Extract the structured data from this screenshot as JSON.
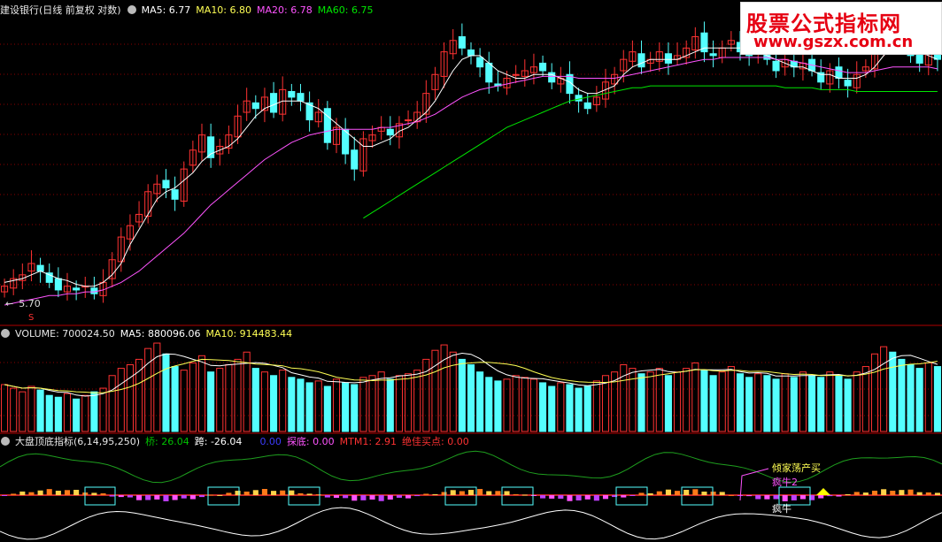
{
  "logo": {
    "line1": "股票公式指标网",
    "line2": "www.gszx.com.cn"
  },
  "price_panel": {
    "title": "建设银行(日线 前复权 对数)",
    "ma5": "MA5: 6.77",
    "ma10": "MA10: 6.80",
    "ma20": "MA20: 6.78",
    "ma60": "MA60: 6.75",
    "low_label": "5.70",
    "marker": "S"
  },
  "volume_panel": {
    "vol": "VOLUME: 700024.50",
    "ma5": "MA5: 880096.06",
    "ma10": "MA10: 914483.44"
  },
  "indicator_panel": {
    "name": "大盘顶底指标(6,14,95,250)",
    "qiao": "桥: 26.04",
    "kua": "跨: -26.04",
    "zero": "0.00",
    "tandi": "探底: 0.00",
    "mtm1": "MTM1: 2.91",
    "jiajia": "绝佳买点: 0.00",
    "annot_a": "倾家荡产买",
    "annot_b": "疯牛2",
    "annot_c": "疯牛"
  },
  "colors": {
    "up": "#ff3232",
    "down": "#54ffff",
    "ma5": "#ffffff",
    "ma10": "#ffff54",
    "ma20": "#ff54ff",
    "ma60": "#00e600",
    "grid": "#8b0000"
  },
  "chart_data": {
    "type": "candlestick",
    "price_close": [
      5.72,
      5.76,
      5.78,
      5.84,
      5.8,
      5.74,
      5.7,
      5.72,
      5.7,
      5.72,
      5.68,
      5.74,
      5.86,
      5.98,
      6.04,
      6.1,
      6.22,
      6.26,
      6.24,
      6.18,
      6.34,
      6.44,
      6.52,
      6.4,
      6.46,
      6.52,
      6.62,
      6.7,
      6.66,
      6.72,
      6.64,
      6.76,
      6.72,
      6.7,
      6.6,
      6.64,
      6.48,
      6.56,
      6.42,
      6.34,
      6.5,
      6.52,
      6.56,
      6.52,
      6.58,
      6.6,
      6.64,
      6.74,
      6.84,
      6.96,
      7.02,
      6.98,
      6.94,
      6.88,
      6.8,
      6.78,
      6.82,
      6.84,
      6.86,
      6.88,
      6.86,
      6.8,
      6.82,
      6.74,
      6.7,
      6.66,
      6.72,
      6.8,
      6.84,
      6.92,
      6.96,
      6.88,
      6.92,
      6.96,
      6.9,
      6.94,
      6.98,
      7.04,
      6.96,
      6.94,
      6.98,
      7.02,
      6.96,
      6.94,
      6.98,
      6.92,
      6.86,
      6.92,
      6.88,
      6.9,
      6.86,
      6.8,
      6.86,
      6.82,
      6.78,
      6.84,
      6.88,
      7.0,
      7.08,
      7.04,
      6.98,
      6.94,
      6.9,
      6.96,
      6.92
    ],
    "ma5": [
      5.74,
      5.75,
      5.76,
      5.78,
      5.8,
      5.78,
      5.76,
      5.75,
      5.73,
      5.72,
      5.72,
      5.74,
      5.78,
      5.84,
      5.94,
      6.02,
      6.1,
      6.18,
      6.22,
      6.24,
      6.28,
      6.32,
      6.38,
      6.42,
      6.44,
      6.46,
      6.5,
      6.56,
      6.62,
      6.66,
      6.68,
      6.7,
      6.7,
      6.7,
      6.68,
      6.66,
      6.62,
      6.58,
      6.54,
      6.5,
      6.46,
      6.46,
      6.48,
      6.5,
      6.54,
      6.56,
      6.6,
      6.64,
      6.7,
      6.78,
      6.86,
      6.92,
      6.94,
      6.94,
      6.9,
      6.86,
      6.84,
      6.82,
      6.82,
      6.84,
      6.84,
      6.84,
      6.82,
      6.8,
      6.76,
      6.74,
      6.74,
      6.76,
      6.78,
      6.84,
      6.88,
      6.9,
      6.92,
      6.92,
      6.92,
      6.92,
      6.94,
      6.96,
      6.98,
      6.98,
      6.98,
      6.98,
      6.98,
      6.96,
      6.96,
      6.94,
      6.92,
      6.9,
      6.88,
      6.88,
      6.86,
      6.84,
      6.84,
      6.82,
      6.82,
      6.82,
      6.84,
      6.88,
      6.94,
      6.98,
      7.0,
      6.98,
      6.96,
      6.94,
      6.92
    ],
    "ma20": [
      5.62,
      5.63,
      5.64,
      5.65,
      5.66,
      5.67,
      5.67,
      5.68,
      5.68,
      5.69,
      5.69,
      5.7,
      5.72,
      5.74,
      5.77,
      5.8,
      5.84,
      5.88,
      5.92,
      5.96,
      6.0,
      6.05,
      6.1,
      6.15,
      6.19,
      6.23,
      6.27,
      6.31,
      6.35,
      6.39,
      6.42,
      6.45,
      6.48,
      6.5,
      6.52,
      6.53,
      6.54,
      6.55,
      6.55,
      6.55,
      6.55,
      6.55,
      6.56,
      6.56,
      6.57,
      6.58,
      6.59,
      6.61,
      6.63,
      6.66,
      6.69,
      6.72,
      6.74,
      6.76,
      6.77,
      6.78,
      6.79,
      6.8,
      6.81,
      6.82,
      6.83,
      6.83,
      6.83,
      6.83,
      6.82,
      6.82,
      6.82,
      6.82,
      6.82,
      6.83,
      6.84,
      6.85,
      6.86,
      6.87,
      6.88,
      6.89,
      6.9,
      6.91,
      6.92,
      6.92,
      6.93,
      6.93,
      6.93,
      6.93,
      6.93,
      6.93,
      6.92,
      6.92,
      6.91,
      6.9,
      6.89,
      6.88,
      6.87,
      6.86,
      6.85,
      6.85,
      6.85,
      6.86,
      6.87,
      6.88,
      6.88,
      6.88,
      6.88,
      6.88,
      6.87
    ],
    "ma60_start_index": 40,
    "ma60": [
      6.08,
      6.11,
      6.14,
      6.17,
      6.2,
      6.23,
      6.26,
      6.29,
      6.32,
      6.35,
      6.38,
      6.41,
      6.44,
      6.47,
      6.5,
      6.53,
      6.56,
      6.58,
      6.6,
      6.62,
      6.64,
      6.66,
      6.68,
      6.7,
      6.71,
      6.72,
      6.73,
      6.74,
      6.75,
      6.76,
      6.77,
      6.77,
      6.78,
      6.78,
      6.78,
      6.78,
      6.78,
      6.78,
      6.78,
      6.78,
      6.78,
      6.78,
      6.78,
      6.78,
      6.78,
      6.78,
      6.78,
      6.77,
      6.77,
      6.77,
      6.77,
      6.76,
      6.76,
      6.76,
      6.76,
      6.75,
      6.75,
      6.75,
      6.75,
      6.75,
      6.75,
      6.75,
      6.75,
      6.75,
      6.75
    ],
    "volume": [
      0.52,
      0.48,
      0.44,
      0.5,
      0.46,
      0.4,
      0.38,
      0.42,
      0.36,
      0.4,
      0.44,
      0.48,
      0.62,
      0.7,
      0.74,
      0.8,
      0.92,
      0.98,
      0.86,
      0.72,
      0.68,
      0.76,
      0.84,
      0.66,
      0.7,
      0.74,
      0.8,
      0.88,
      0.7,
      0.66,
      0.62,
      0.68,
      0.6,
      0.58,
      0.54,
      0.56,
      0.5,
      0.58,
      0.54,
      0.52,
      0.6,
      0.62,
      0.66,
      0.58,
      0.62,
      0.64,
      0.68,
      0.8,
      0.9,
      0.96,
      0.88,
      0.8,
      0.74,
      0.66,
      0.6,
      0.56,
      0.58,
      0.62,
      0.6,
      0.58,
      0.54,
      0.5,
      0.54,
      0.52,
      0.48,
      0.5,
      0.56,
      0.62,
      0.66,
      0.74,
      0.7,
      0.64,
      0.66,
      0.7,
      0.62,
      0.66,
      0.7,
      0.76,
      0.68,
      0.62,
      0.66,
      0.72,
      0.64,
      0.6,
      0.64,
      0.62,
      0.58,
      0.64,
      0.6,
      0.66,
      0.62,
      0.6,
      0.66,
      0.62,
      0.58,
      0.66,
      0.72,
      0.86,
      0.94,
      0.88,
      0.8,
      0.74,
      0.7,
      0.76,
      0.72
    ],
    "vol_ylim": [
      0,
      1.0
    ]
  }
}
